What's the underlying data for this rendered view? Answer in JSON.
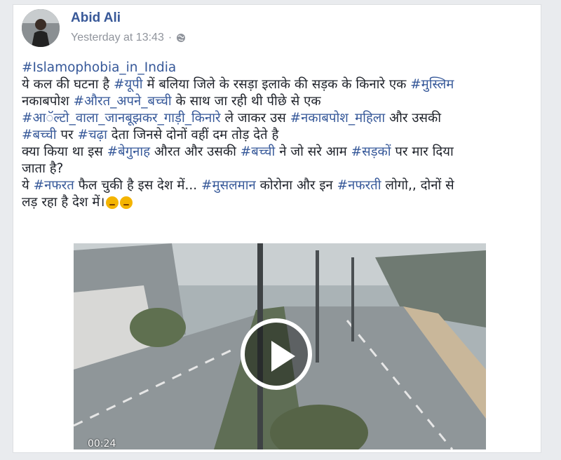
{
  "post": {
    "author": "Abid Ali",
    "timestamp": "Yesterday at 13:43",
    "separator": "·",
    "privacy_icon": "globe-icon",
    "lines": [
      [
        {
          "t": "#Islamophobia_in_India",
          "tag": true
        }
      ],
      [
        {
          "t": "ये कल की घटना है ",
          "tag": false
        },
        {
          "t": "#यूपी",
          "tag": true
        },
        {
          "t": " में बलिया जिले के रसड़ा इलाके की सड़क के किनारे एक ",
          "tag": false
        },
        {
          "t": "#मुस्लिम",
          "tag": true
        }
      ],
      [
        {
          "t": "नकाबपोश ",
          "tag": false
        },
        {
          "t": "#औरत_अपने_बच्ची",
          "tag": true
        },
        {
          "t": " के साथ जा रही थी पीछे से एक",
          "tag": false
        }
      ],
      [
        {
          "t": "#आॅल्टो_वाला_जानबूझकर_गाड़ी_किनारे",
          "tag": true
        },
        {
          "t": " ले जाकर उस ",
          "tag": false
        },
        {
          "t": "#नकाबपोश_महिला",
          "tag": true
        },
        {
          "t": " और उसकी",
          "tag": false
        }
      ],
      [
        {
          "t": "#बच्ची",
          "tag": true
        },
        {
          "t": " पर ",
          "tag": false
        },
        {
          "t": "#चढ़ा",
          "tag": true
        },
        {
          "t": " देता जिनसे दोनों वहीं दम तोड़ देते है",
          "tag": false
        }
      ],
      [
        {
          "t": "क्या किया था इस ",
          "tag": false
        },
        {
          "t": "#बेगुनाह",
          "tag": true
        },
        {
          "t": " औरत और उसकी ",
          "tag": false
        },
        {
          "t": "#बच्ची",
          "tag": true
        },
        {
          "t": " ने जो सरे आम ",
          "tag": false
        },
        {
          "t": "#सड़कों",
          "tag": true
        },
        {
          "t": " पर मार दिया",
          "tag": false
        }
      ],
      [
        {
          "t": "जाता है?",
          "tag": false
        }
      ],
      [
        {
          "t": "ये ",
          "tag": false
        },
        {
          "t": "#नफरत",
          "tag": true
        },
        {
          "t": " फैल चुकी है इस देश में... ",
          "tag": false
        },
        {
          "t": "#मुसलमान",
          "tag": true
        },
        {
          "t": " कोरोना और इन ",
          "tag": false
        },
        {
          "t": "#नफरती",
          "tag": true
        },
        {
          "t": " लोगो,, दोनों से",
          "tag": false
        }
      ],
      [
        {
          "t": "लड़ रहा है देश में।",
          "tag": false
        },
        {
          "emoji": "angry-face-icon"
        },
        {
          "emoji": "angry-face-icon"
        }
      ]
    ]
  },
  "video": {
    "timecode": "00:24",
    "play_icon": "play-icon"
  },
  "colors": {
    "link": "#385898",
    "hashtag": "#365899",
    "meta": "#90949c",
    "text": "#1d2129"
  }
}
